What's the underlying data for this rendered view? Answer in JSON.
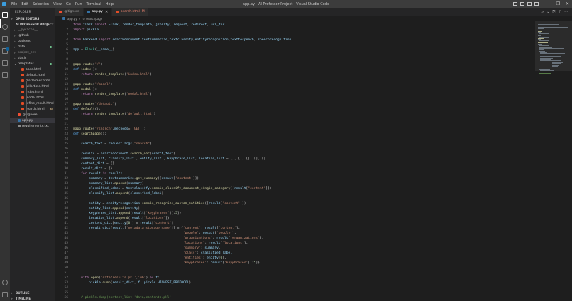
{
  "window": {
    "title": "app.py - AI Professor Project - Visual Studio Code",
    "menu": [
      "File",
      "Edit",
      "Selection",
      "View",
      "Go",
      "Run",
      "Terminal",
      "Help"
    ],
    "controls": [
      "—",
      "❐",
      "✕"
    ]
  },
  "sidebar": {
    "title": "EXPLORER",
    "more_icon": "···",
    "open_editors": "OPEN EDITORS",
    "project": "AI PROFESSOR PROJECT",
    "tree": [
      {
        "label": "__pycache__",
        "type": "folder",
        "dim": true
      },
      {
        "label": ".github",
        "type": "folder"
      },
      {
        "label": "backend",
        "type": "folder"
      },
      {
        "label": "data",
        "type": "folder",
        "status": "dot"
      },
      {
        "label": "project_env",
        "type": "folder",
        "dim": true
      },
      {
        "label": "static",
        "type": "folder"
      },
      {
        "label": "templates",
        "type": "folder-open",
        "status": "dot"
      },
      {
        "label": "base.html",
        "type": "html"
      },
      {
        "label": "default.html",
        "type": "html"
      },
      {
        "label": "disclaimer.html",
        "type": "html"
      },
      {
        "label": "fullarticle.html",
        "type": "html"
      },
      {
        "label": "index.html",
        "type": "html"
      },
      {
        "label": "modal.html",
        "type": "html"
      },
      {
        "label": "refine_result.html",
        "type": "html"
      },
      {
        "label": "search.html",
        "type": "html",
        "status": "M"
      },
      {
        "label": ".gitignore",
        "type": "git"
      },
      {
        "label": "app.py",
        "type": "py",
        "selected": true
      },
      {
        "label": "requirements.txt",
        "type": "txt"
      }
    ],
    "outline": "OUTLINE",
    "timeline": "TIMELINE"
  },
  "tabs": [
    {
      "label": ".gitignore",
      "icon": "git",
      "active": false
    },
    {
      "label": "app.py",
      "icon": "py",
      "active": true,
      "close": "✕"
    },
    {
      "label": "search.html",
      "icon": "html",
      "active": false,
      "status": "M"
    }
  ],
  "tab_actions": [
    "▷",
    "⌄",
    "⎘",
    "◫",
    "···"
  ],
  "breadcrumb": [
    "app.py",
    "›",
    "⊙ searchpage"
  ],
  "code_lines": [
    {
      "n": "1",
      "t": "from flask import Flask, render_template, jsonify, request, redirect, url_for"
    },
    {
      "n": "2",
      "t": "import pickle"
    },
    {
      "n": "3",
      "t": ""
    },
    {
      "n": "4",
      "t": "from backend import searchdocument,textsummarize,textclassify,entityrecognition,texttospeech, speechrecognition"
    },
    {
      "n": "5",
      "t": ""
    },
    {
      "n": "6",
      "t": "app = Flask(__name__)"
    },
    {
      "n": "7",
      "t": ""
    },
    {
      "n": "8",
      "t": ""
    },
    {
      "n": "9",
      "t": "@app.route('/')"
    },
    {
      "n": "10",
      "t": "def index():"
    },
    {
      "n": "11",
      "t": "    return render_template('index.html')"
    },
    {
      "n": "12",
      "t": ""
    },
    {
      "n": "13",
      "t": "@app.route('/modal')"
    },
    {
      "n": "14",
      "t": "def modal():"
    },
    {
      "n": "15",
      "t": "    return render_template('modal.html')"
    },
    {
      "n": "16",
      "t": ""
    },
    {
      "n": "17",
      "t": "@app.route('/default')"
    },
    {
      "n": "18",
      "t": "def default():"
    },
    {
      "n": "19",
      "t": "    return render_template('default.html')"
    },
    {
      "n": "20",
      "t": ""
    },
    {
      "n": "21",
      "t": ""
    },
    {
      "n": "22",
      "t": "@app.route('/search',methods=['GET'])"
    },
    {
      "n": "23",
      "t": "def searchpage():"
    },
    {
      "n": "24",
      "t": ""
    },
    {
      "n": "25",
      "t": "    search_text = request.args[\"search\"]"
    },
    {
      "n": "26",
      "t": ""
    },
    {
      "n": "27",
      "t": "    results = searchdocument.search_doc(search_text)"
    },
    {
      "n": "28",
      "t": "    summary_list, classify_list , entity_list , keyphrase_list, location_list = [], [], [], [], []"
    },
    {
      "n": "29",
      "t": "    content_dict = {}"
    },
    {
      "n": "30",
      "t": "    result_dict = {}"
    },
    {
      "n": "31",
      "t": "    for result in results:"
    },
    {
      "n": "32",
      "t": "        summary = textsummarize.get_summary([result['content']])"
    },
    {
      "n": "33",
      "t": "        summary_list.append(summary)"
    },
    {
      "n": "34",
      "t": "        classified_label = textclassify.sample_classify_document_single_category([result[\"content\"]])"
    },
    {
      "n": "35",
      "t": "        classify_list.append(classified_label)"
    },
    {
      "n": "36",
      "t": ""
    },
    {
      "n": "37",
      "t": "        entity = entityrecognition.sample_recognize_custom_entities([result['content']])"
    },
    {
      "n": "38",
      "t": "        entity_list.append(entity)"
    },
    {
      "n": "39",
      "t": "        keyphrase_list.append(result['keyphrases'][:5])"
    },
    {
      "n": "40",
      "t": "        location_list.append(result['locations'])"
    },
    {
      "n": "41",
      "t": "        content_dict[entity[0]] = result['content']"
    },
    {
      "n": "42",
      "t": "        result_dict[result['metadata_storage_name']] = {'content': result['content'],"
    },
    {
      "n": "43",
      "t": "                                                        'people': result['people'],"
    },
    {
      "n": "44",
      "t": "                                                        'organizations': result['organizations'],"
    },
    {
      "n": "45",
      "t": "                                                        'locations': result['locations'],"
    },
    {
      "n": "46",
      "t": "                                                        'summary': summary,"
    },
    {
      "n": "47",
      "t": "                                                        'class': classified_label,"
    },
    {
      "n": "48",
      "t": "                                                        'entities': entity[0],"
    },
    {
      "n": "49",
      "t": "                                                        'keyphrases': result['keyphrases'][:5]}"
    },
    {
      "n": "50",
      "t": ""
    },
    {
      "n": "51",
      "t": ""
    },
    {
      "n": "52",
      "t": "    with open('data/results.pkl','wb') as f:"
    },
    {
      "n": "53",
      "t": "        pickle.dump(result_dict, f, pickle.HIGHEST_PROTOCOL)"
    },
    {
      "n": "54",
      "t": ""
    },
    {
      "n": "55",
      "t": ""
    },
    {
      "n": "56",
      "t": "    # pickle.dump(content_list,'data/contents.pkl')"
    }
  ],
  "colors": {
    "keyword": "#c586c0",
    "def": "#569cd6",
    "function": "#dcdcaa",
    "string": "#ce9178",
    "variable": "#9cdcfe",
    "comment": "#6a9955",
    "class": "#4ec9b0",
    "number": "#b5cea8",
    "default": "#d4d4d4"
  }
}
